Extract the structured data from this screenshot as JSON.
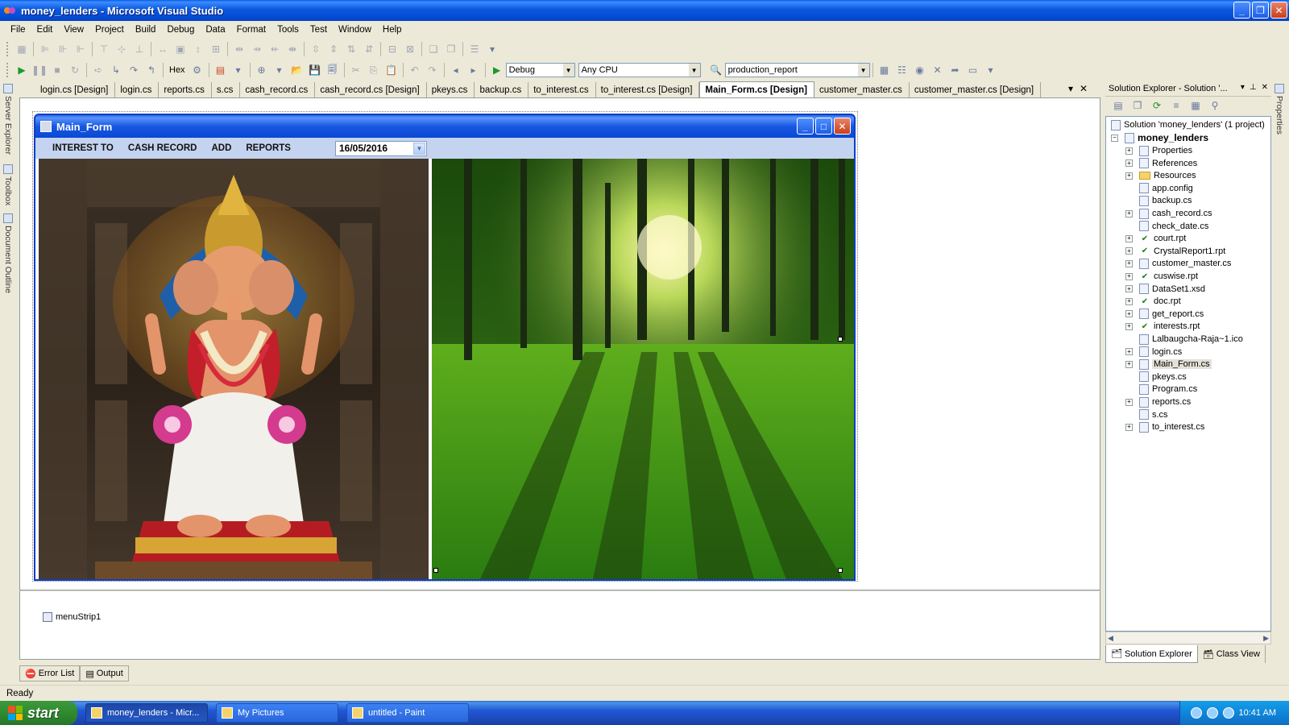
{
  "window": {
    "title": "money_lenders - Microsoft Visual Studio"
  },
  "menu": [
    "File",
    "Edit",
    "View",
    "Project",
    "Build",
    "Debug",
    "Data",
    "Format",
    "Tools",
    "Test",
    "Window",
    "Help"
  ],
  "toolbar2": {
    "hex_label": "Hex",
    "config": "Debug",
    "platform": "Any CPU",
    "find": "production_report"
  },
  "side_tabs": [
    "Server Explorer",
    "Toolbox",
    "Document Outline"
  ],
  "right_side_tab": "Properties",
  "doc_tabs": [
    {
      "label": "login.cs [Design]",
      "active": false
    },
    {
      "label": "login.cs",
      "active": false
    },
    {
      "label": "reports.cs",
      "active": false
    },
    {
      "label": "s.cs",
      "active": false
    },
    {
      "label": "cash_record.cs",
      "active": false
    },
    {
      "label": "cash_record.cs [Design]",
      "active": false
    },
    {
      "label": "pkeys.cs",
      "active": false
    },
    {
      "label": "backup.cs",
      "active": false
    },
    {
      "label": "to_interest.cs",
      "active": false
    },
    {
      "label": "to_interest.cs [Design]",
      "active": false
    },
    {
      "label": "Main_Form.cs [Design]",
      "active": true
    },
    {
      "label": "customer_master.cs",
      "active": false
    },
    {
      "label": "customer_master.cs [Design]",
      "active": false
    }
  ],
  "form": {
    "title": "Main_Form",
    "menu": [
      "INTEREST TO",
      "CASH RECORD",
      "ADD",
      "REPORTS"
    ],
    "date": "16/05/2016"
  },
  "tray": {
    "component": "menuStrip1"
  },
  "solution_explorer": {
    "title": "Solution Explorer - Solution '...",
    "solution": "Solution 'money_lenders' (1 project)",
    "project": "money_lenders",
    "items": [
      {
        "label": "Properties",
        "icon": "properties-icon",
        "expandable": true
      },
      {
        "label": "References",
        "icon": "references-icon",
        "expandable": true
      },
      {
        "label": "Resources",
        "icon": "folder-icon",
        "expandable": true
      },
      {
        "label": "app.config",
        "icon": "config-file-icon",
        "expandable": false
      },
      {
        "label": "backup.cs",
        "icon": "cs-file-icon",
        "expandable": false
      },
      {
        "label": "cash_record.cs",
        "icon": "form-file-icon",
        "expandable": true
      },
      {
        "label": "check_date.cs",
        "icon": "cs-file-icon",
        "expandable": false
      },
      {
        "label": "court.rpt",
        "icon": "report-icon",
        "expandable": true
      },
      {
        "label": "CrystalReport1.rpt",
        "icon": "report-icon",
        "expandable": true
      },
      {
        "label": "customer_master.cs",
        "icon": "form-file-icon",
        "expandable": true
      },
      {
        "label": "cuswise.rpt",
        "icon": "report-icon",
        "expandable": true
      },
      {
        "label": "DataSet1.xsd",
        "icon": "dataset-icon",
        "expandable": true
      },
      {
        "label": "doc.rpt",
        "icon": "report-icon",
        "expandable": true
      },
      {
        "label": "get_report.cs",
        "icon": "form-file-icon",
        "expandable": true
      },
      {
        "label": "interests.rpt",
        "icon": "report-icon",
        "expandable": true
      },
      {
        "label": "Lalbaugcha-Raja~1.ico",
        "icon": "ico-file-icon",
        "expandable": false
      },
      {
        "label": "login.cs",
        "icon": "form-file-icon",
        "expandable": true
      },
      {
        "label": "Main_Form.cs",
        "icon": "form-file-icon",
        "expandable": true,
        "selected": true
      },
      {
        "label": "pkeys.cs",
        "icon": "cs-file-icon",
        "expandable": false
      },
      {
        "label": "Program.cs",
        "icon": "cs-file-icon",
        "expandable": false
      },
      {
        "label": "reports.cs",
        "icon": "form-file-icon",
        "expandable": true
      },
      {
        "label": "s.cs",
        "icon": "cs-file-icon",
        "expandable": false
      },
      {
        "label": "to_interest.cs",
        "icon": "form-file-icon",
        "expandable": true
      }
    ],
    "tabs": [
      "Solution Explorer",
      "Class View"
    ]
  },
  "bottom_tabs": [
    "Error List",
    "Output"
  ],
  "status": "Ready",
  "taskbar": {
    "start": "start",
    "tasks": [
      "money_lenders - Micr...",
      "My Pictures",
      "untitled - Paint"
    ],
    "clock": "10:41 AM"
  }
}
